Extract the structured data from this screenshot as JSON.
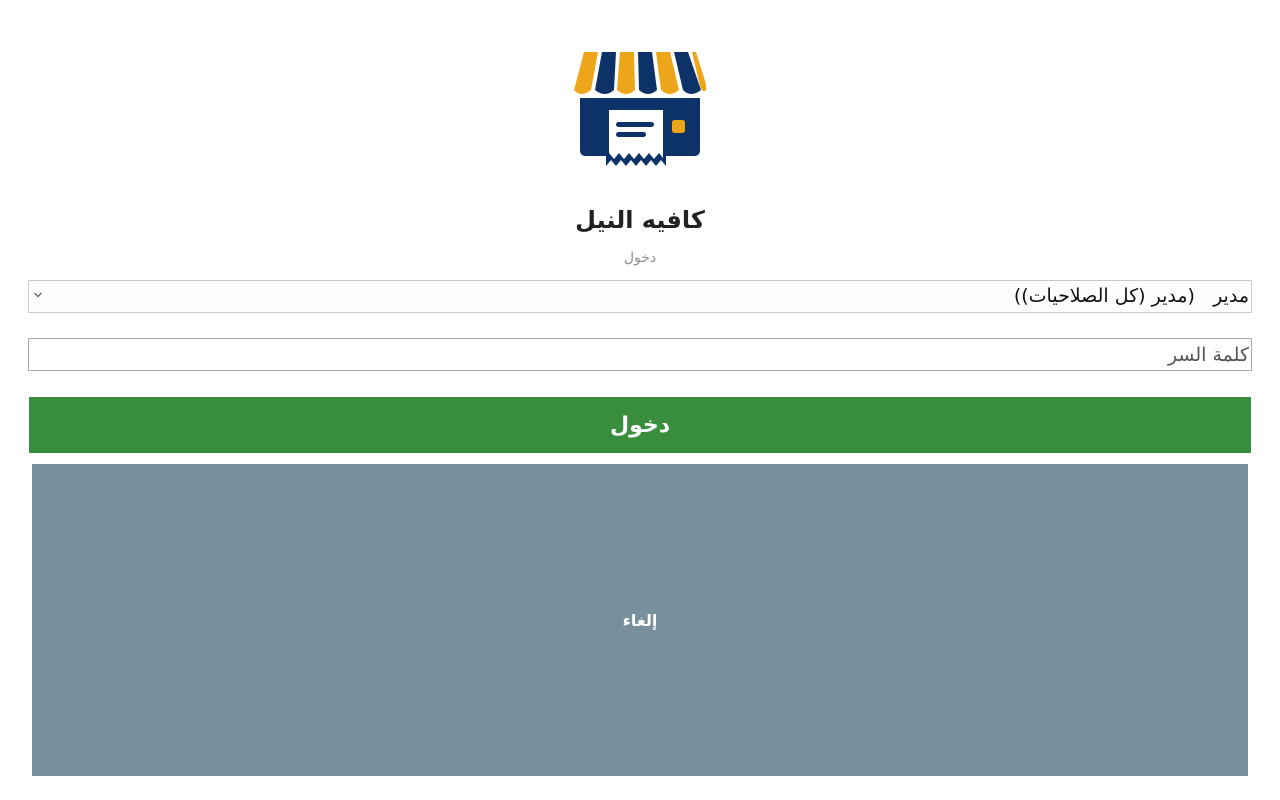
{
  "app": {
    "title": "كافيه النيل",
    "subtitle": "دخول",
    "logo_icon": "shop-receipt-icon"
  },
  "colors": {
    "awning_yellow": "#eda51a",
    "awning_blue": "#0d3268",
    "login_green": "#388e3c",
    "cancel_gray": "#78909c"
  },
  "form": {
    "user_select": {
      "selected_value": "مدير   (مدير (كل الصلاحيات))"
    },
    "password": {
      "value": "",
      "placeholder": "كلمة السر"
    },
    "login_label": "دخول",
    "cancel_label": "إلغاء"
  }
}
